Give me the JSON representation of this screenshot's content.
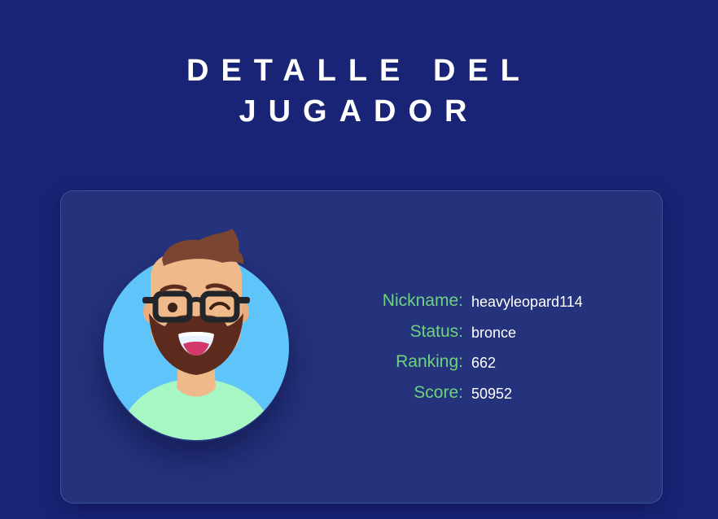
{
  "page": {
    "title_line1": "DETALLE DEL",
    "title_line2": "JUGADOR"
  },
  "player": {
    "avatar_icon": "bearded-man-avatar-icon",
    "fields": [
      {
        "label": "Nickname:",
        "value": "heavyleopard114"
      },
      {
        "label": "Status:",
        "value": "bronce"
      },
      {
        "label": "Ranking:",
        "value": "662"
      },
      {
        "label": "Score:",
        "value": "50952"
      }
    ]
  },
  "colors": {
    "background": "#1a2477",
    "card": "#25327c",
    "label": "#6ed37e",
    "value": "#ffffff",
    "avatar_bg": "#5ec4f9",
    "shirt": "#a6f7c4"
  }
}
